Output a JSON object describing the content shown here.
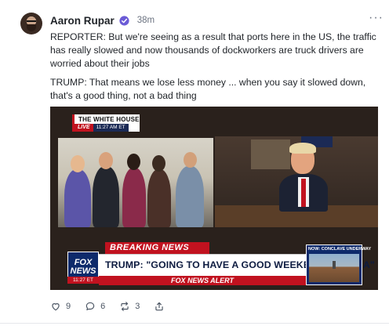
{
  "post": {
    "author": "Aaron Rupar",
    "time": "38m",
    "paragraphs": [
      "REPORTER: But we're seeing as a result that ports here in the US, the traffic has really slowed and now thousands of dockworkers are truck drivers are worried about their jobs",
      "TRUMP: That means we lose less money ... when you say it slowed down, that's a good thing, not a bad thing"
    ]
  },
  "media": {
    "location_label": "THE WHITE HOUSE",
    "live_label": "LIVE",
    "live_time": "11:27 AM ET",
    "breaking_label": "BREAKING NEWS",
    "headline": "TRUMP: \"GOING TO HAVE A GOOD WEEKEND W/CHINA\"",
    "alert_label": "FOX NEWS ALERT",
    "logo_line1": "FOX",
    "logo_line2": "NEWS",
    "logo_time": "11:27 ET",
    "inset_label": "NOW: CONCLAVE UNDERWAY"
  },
  "actions": {
    "likes": "9",
    "replies": "6",
    "reposts": "3"
  },
  "colors": {
    "verified": "#6b5bd6",
    "fox_red": "#c1121f",
    "fox_blue": "#0d2a6b"
  },
  "icons": [
    "verified-badge-icon",
    "more-icon",
    "heart-icon",
    "reply-icon",
    "repost-icon",
    "share-icon"
  ]
}
